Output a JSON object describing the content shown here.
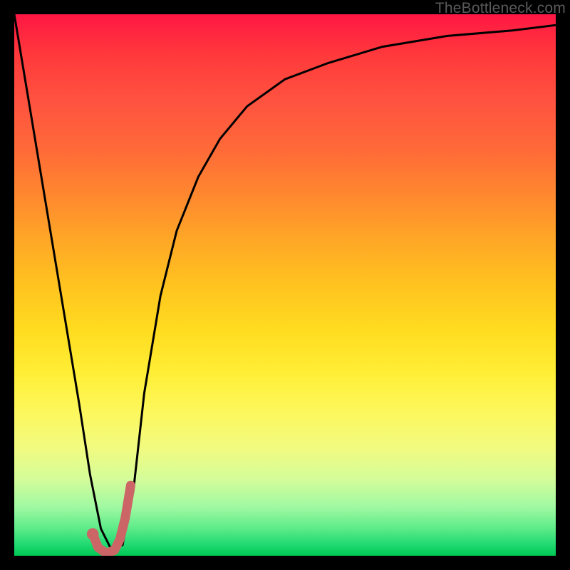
{
  "watermark": "TheBottleneck.com",
  "chart_data": {
    "type": "line",
    "title": "",
    "xlabel": "",
    "ylabel": "",
    "xlim": [
      0,
      100
    ],
    "ylim": [
      0,
      100
    ],
    "background_gradient": {
      "direction": "vertical",
      "stops": [
        {
          "pos": 0,
          "color": "#ff1744"
        },
        {
          "pos": 50,
          "color": "#ffc31f"
        },
        {
          "pos": 73,
          "color": "#fdf75a"
        },
        {
          "pos": 100,
          "color": "#00c853"
        }
      ]
    },
    "series": [
      {
        "name": "bottleneck-curve",
        "color": "#000000",
        "stroke_width": 3,
        "x": [
          0,
          3,
          6,
          9,
          12,
          14,
          16,
          18,
          20,
          22,
          24,
          27,
          30,
          34,
          38,
          43,
          50,
          58,
          68,
          80,
          92,
          100
        ],
        "values": [
          100,
          82,
          64,
          46,
          28,
          15,
          5,
          1,
          2,
          12,
          30,
          48,
          60,
          70,
          77,
          83,
          88,
          91,
          94,
          96,
          97,
          98
        ]
      },
      {
        "name": "highlight-segment",
        "color": "#cc6666",
        "stroke_width": 13,
        "linecap": "round",
        "x": [
          14.5,
          15.5,
          17.0,
          18.5,
          19.5,
          20.5,
          21.5
        ],
        "values": [
          4.0,
          1.5,
          0.5,
          1.0,
          3.0,
          7.0,
          13.0
        ]
      }
    ],
    "marker": {
      "name": "min-point",
      "x": 14.5,
      "y": 4.0,
      "r": 1.1,
      "color": "#cc6666"
    }
  }
}
